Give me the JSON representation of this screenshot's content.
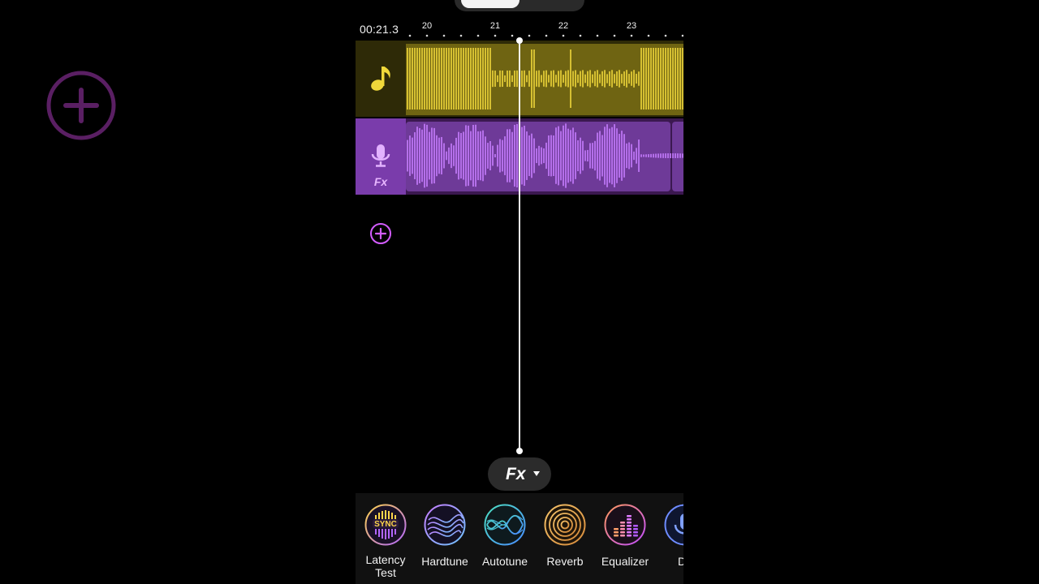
{
  "timeline": {
    "time_readout": "00:21.3",
    "ruler_labels": [
      "20",
      "21",
      "22",
      "23"
    ]
  },
  "tracks": [
    {
      "type": "music",
      "icon": "music-note-icon",
      "color": "#f0d83a"
    },
    {
      "type": "vocal",
      "icon": "microphone-icon",
      "fx_label": "Fx",
      "color": "#c77dff"
    }
  ],
  "fx_selector": {
    "label": "Fx"
  },
  "effects": [
    {
      "name": "Latency Test",
      "badge": "SYNC",
      "icon": "sync-icon"
    },
    {
      "name": "Hardtune",
      "icon": "hardtune-icon"
    },
    {
      "name": "Autotune",
      "icon": "autotune-icon"
    },
    {
      "name": "Reverb",
      "icon": "reverb-icon"
    },
    {
      "name": "Equalizer",
      "icon": "equalizer-icon"
    },
    {
      "name": "Du",
      "icon": "mic-effect-icon"
    }
  ],
  "colors": {
    "music": "#f0d83a",
    "vocal": "#c77dff",
    "accent": "#d35cff"
  }
}
